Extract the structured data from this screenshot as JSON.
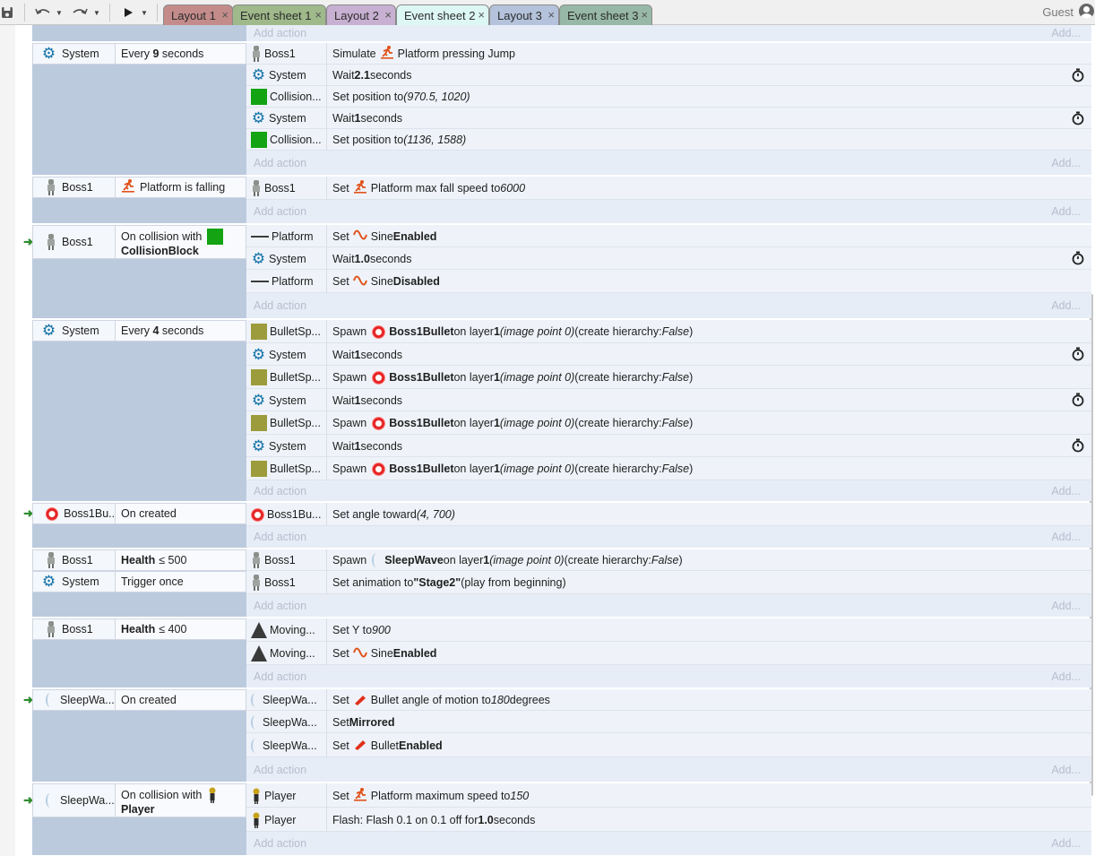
{
  "tabs": [
    {
      "label": "Layout 1",
      "color": "#c48b8b"
    },
    {
      "label": "Event sheet 1",
      "color": "#9fb98a"
    },
    {
      "label": "Layout 2",
      "color": "#c7b0d1"
    },
    {
      "label": "Event sheet 2",
      "color": "#ddf7f4"
    },
    {
      "label": "Layout 3",
      "color": "#b4c3db"
    },
    {
      "label": "Event sheet 3",
      "color": "#97b8a6"
    }
  ],
  "tab_close": "×",
  "guest": "Guest",
  "add_action": "Add action",
  "add_short": "Add...",
  "events": [
    {
      "conds": [
        {
          "obj": "System",
          "text_parts": [
            "Every ",
            "9",
            " seconds"
          ]
        }
      ],
      "actions": [
        {
          "obj": "Boss1",
          "text": "Simulate",
          "extra": "Platform pressing Jump"
        },
        {
          "obj": "System",
          "text": "Wait",
          "bold": "2.1",
          "after": "seconds"
        },
        {
          "obj": "Collision...",
          "text": "Set position to",
          "it": "(970.5, 1020)"
        },
        {
          "obj": "System",
          "text": "Wait",
          "bold": "1",
          "after": "seconds"
        },
        {
          "obj": "Collision...",
          "text": "Set position to",
          "it": "(1136, 1588)"
        }
      ]
    },
    {
      "conds": [
        {
          "obj": "Boss1",
          "text": "Platform is falling"
        }
      ],
      "actions": [
        {
          "obj": "Boss1",
          "text": "Set",
          "extra": "Platform max fall speed to",
          "it": "6000"
        }
      ]
    },
    {
      "conds": [
        {
          "obj": "Boss1",
          "text": "On collision with",
          "bold": "CollisionBlock"
        }
      ],
      "actions": [
        {
          "obj": "Platform",
          "text": "Set",
          "extra": "Sine",
          "bold": "Enabled"
        },
        {
          "obj": "System",
          "text": "Wait",
          "bold": "1.0",
          "after": "seconds"
        },
        {
          "obj": "Platform",
          "text": "Set",
          "extra": "Sine",
          "bold": "Disabled"
        }
      ]
    },
    {
      "conds": [
        {
          "obj": "System",
          "text_parts": [
            "Every ",
            "4",
            " seconds"
          ]
        }
      ],
      "actions": [
        {
          "obj": "BulletSp...",
          "text": "Spawn",
          "bold": "Boss1Bullet",
          "mid": "on layer",
          "bold2": "1",
          "it": "(image point 0)",
          "tail": "(create hierarchy:",
          "it2": "False",
          ")": ")"
        },
        {
          "obj": "System",
          "text": "Wait",
          "bold": "1",
          "after": "seconds"
        },
        {
          "obj": "BulletSp...",
          "text": "Spawn",
          "bold": "Boss1Bullet",
          "mid": "on layer",
          "bold2": "1",
          "it": "(image point 0)",
          "tail": "(create hierarchy:",
          "it2": "False"
        },
        {
          "obj": "System",
          "text": "Wait",
          "bold": "1",
          "after": "seconds"
        },
        {
          "obj": "BulletSp...",
          "text": "Spawn",
          "bold": "Boss1Bullet",
          "mid": "on layer",
          "bold2": "1",
          "it": "(image point 0)",
          "tail": "(create hierarchy:",
          "it2": "False"
        },
        {
          "obj": "System",
          "text": "Wait",
          "bold": "1",
          "after": "seconds"
        },
        {
          "obj": "BulletSp...",
          "text": "Spawn",
          "bold": "Boss1Bullet",
          "mid": "on layer",
          "bold2": "1",
          "it": "(image point 0)",
          "tail": "(create hierarchy:",
          "it2": "False"
        }
      ]
    },
    {
      "conds": [
        {
          "obj": "Boss1Bu...",
          "text": "On created"
        }
      ],
      "actions": [
        {
          "obj": "Boss1Bu...",
          "text": "Set angle toward",
          "it": "(4, 700)"
        }
      ]
    },
    {
      "conds": [
        {
          "obj": "Boss1",
          "bold": "Health",
          "text": "≤ 500"
        },
        {
          "obj": "System",
          "text": "Trigger once"
        }
      ],
      "actions": [
        {
          "obj": "Boss1",
          "text": "Spawn",
          "bold": "SleepWave",
          "mid": "on layer",
          "bold2": "1",
          "it": "(image point 0)",
          "tail": "(create hierarchy:",
          "it2": "False"
        },
        {
          "obj": "Boss1",
          "text": "Set animation to",
          "bold": "\"Stage2\"",
          "after": "(play from beginning)"
        }
      ]
    },
    {
      "conds": [
        {
          "obj": "Boss1",
          "bold": "Health",
          "text": "≤ 400"
        }
      ],
      "actions": [
        {
          "obj": "Moving...",
          "text": "Set Y to",
          "it": "900"
        },
        {
          "obj": "Moving...",
          "text": "Set",
          "extra": "Sine",
          "bold": "Enabled"
        }
      ]
    },
    {
      "conds": [
        {
          "obj": "SleepWa...",
          "text": "On created"
        }
      ],
      "actions": [
        {
          "obj": "SleepWa...",
          "text": "Set",
          "extra": "Bullet angle of motion to",
          "it": "180",
          "after": "degrees"
        },
        {
          "obj": "SleepWa...",
          "text": "Set",
          "bold": "Mirrored"
        },
        {
          "obj": "SleepWa...",
          "text": "Set",
          "extra": "Bullet",
          "bold": "Enabled"
        }
      ]
    },
    {
      "conds": [
        {
          "obj": "SleepWa...",
          "text": "On collision with",
          "bold": "Player"
        }
      ],
      "actions": [
        {
          "obj": "Player",
          "text": "Set",
          "extra": "Platform maximum speed to",
          "it": "150"
        },
        {
          "obj": "Player",
          "text": "Flash: Flash 0.1 on 0.1 off for",
          "bold": "1.0",
          "after": "seconds"
        }
      ]
    }
  ]
}
